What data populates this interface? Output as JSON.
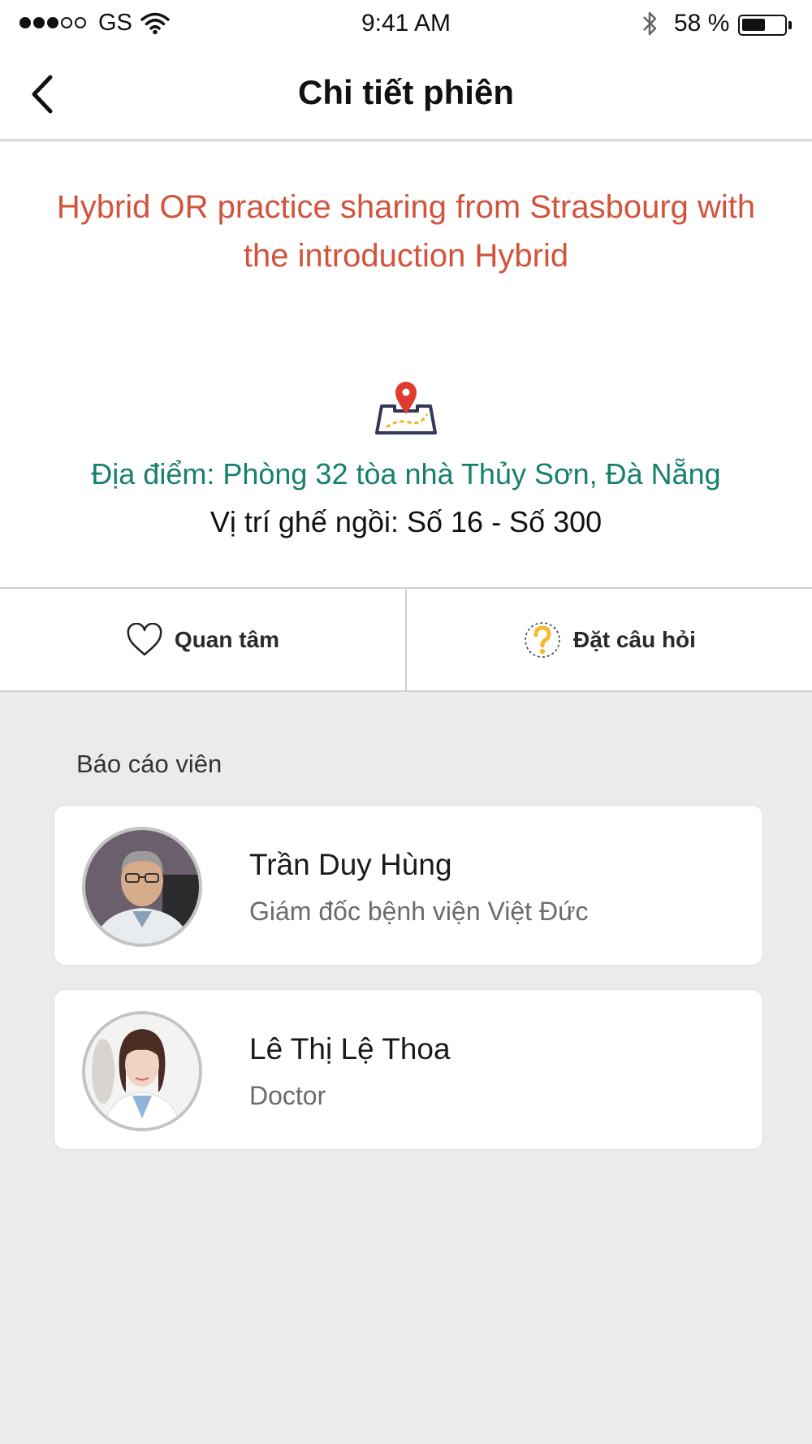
{
  "status_bar": {
    "carrier": "GS",
    "time": "9:41 AM",
    "battery_percent": "58 %",
    "battery_level": 0.58,
    "signal_bars_filled": 3,
    "signal_bars_total": 5
  },
  "nav": {
    "title": "Chi tiết phiên",
    "back_icon": "chevron-left-icon"
  },
  "session": {
    "title": "Hybrid OR practice sharing from Strasbourg with the introduction Hybrid",
    "location": "Địa điểm: Phòng 32 tòa nhà Thủy Sơn, Đà Nẵng",
    "seat": "Vị trí ghế ngồi: Số 16 - Số 300",
    "map_icon": "map-pin-icon"
  },
  "actions": {
    "interest_label": "Quan tâm",
    "interest_icon": "heart-outline-icon",
    "question_label": "Đặt câu hỏi",
    "question_icon": "question-icon"
  },
  "speakers": {
    "section_label": "Báo cáo viên",
    "items": [
      {
        "name": "Trần Duy Hùng",
        "role": "Giám đốc bệnh viện Việt Đức"
      },
      {
        "name": "Lê Thị Lệ Thoa",
        "role": "Doctor"
      }
    ]
  },
  "colors": {
    "title_red": "#d2533b",
    "location_teal": "#17806d",
    "question_yellow": "#f5b82e",
    "map_red": "#e03b2f",
    "background_gray": "#ebebeb"
  }
}
